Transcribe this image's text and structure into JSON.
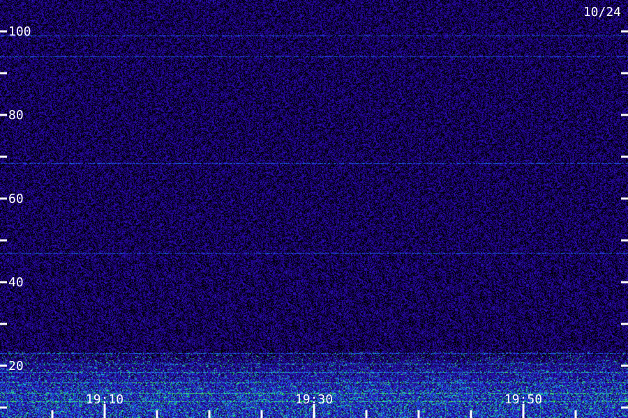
{
  "chart_data": {
    "type": "heatmap",
    "date": "10/24",
    "y_ticks": [
      {
        "value": 100,
        "label": "100"
      },
      {
        "value": 90,
        "label": ""
      },
      {
        "value": 80,
        "label": "80"
      },
      {
        "value": 70,
        "label": ""
      },
      {
        "value": 60,
        "label": "60"
      },
      {
        "value": 50,
        "label": ""
      },
      {
        "value": 40,
        "label": "40"
      },
      {
        "value": 30,
        "label": ""
      },
      {
        "value": 20,
        "label": "20"
      },
      {
        "value": 10,
        "label": ""
      }
    ],
    "x_ticks": [
      {
        "value": "19:05",
        "label": "",
        "major": false
      },
      {
        "value": "19:10",
        "label": "19:10",
        "major": true
      },
      {
        "value": "19:15",
        "label": "",
        "major": false
      },
      {
        "value": "19:20",
        "label": "",
        "major": false
      },
      {
        "value": "19:25",
        "label": "",
        "major": false
      },
      {
        "value": "19:30",
        "label": "19:30",
        "major": true
      },
      {
        "value": "19:35",
        "label": "",
        "major": false
      },
      {
        "value": "19:40",
        "label": "",
        "major": false
      },
      {
        "value": "19:45",
        "label": "",
        "major": false
      },
      {
        "value": "19:50",
        "label": "19:50",
        "major": true
      },
      {
        "value": "19:55",
        "label": "",
        "major": false
      }
    ],
    "ylim": [
      7.5,
      107.5
    ],
    "xlim": [
      "19:00",
      "20:00"
    ],
    "bright_lines_y": [
      99,
      94,
      68.5,
      47,
      23,
      20.5,
      18.5,
      16,
      13.5,
      11.5
    ],
    "colors": {
      "background": "#000000",
      "low": "#2a0a8a",
      "mid": "#3050ff",
      "high": "#20ff80",
      "tick": "#ffffff"
    }
  }
}
